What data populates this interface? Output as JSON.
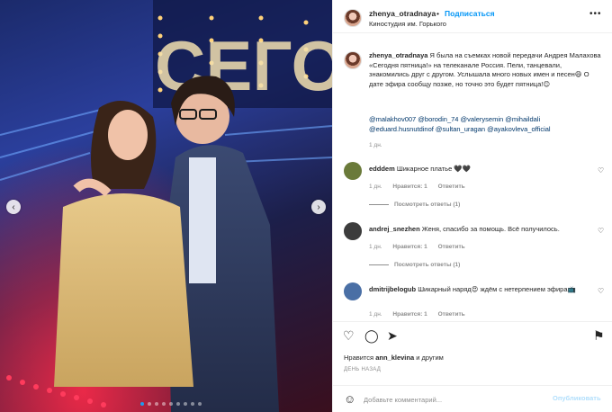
{
  "post": {
    "username": "zhenya_otradnaya",
    "separator": "•",
    "follow_label": "Подписаться",
    "location": "Киностудия им. Горького",
    "more_label": "•••",
    "photo": {
      "sign_text": "СЕГОД",
      "prev_label": "‹",
      "next_label": "›",
      "dot_count": 9,
      "active_dot": 0
    }
  },
  "caption": {
    "username": "zhenya_otradnaya",
    "text": "Я была на съемках новой передачи Андрея Малахова «Сегодня пятница!» на телеканале Россия. Пели, танцевали, знакомились друг с другом. Услышала много новых имен и песен😄 О дате эфира сообщу позже, но точно это будет пятница!😊",
    "mentions": "@malakhov007 @borodin_74 @valerysemin @mihaildali @eduard.husnutdinof @sultan_uragan @ayakovleva_official",
    "time": "1 дн."
  },
  "comments": [
    {
      "username": "edddem",
      "text": "Шикарное платье 🖤🖤",
      "time": "1 дн.",
      "likes": "Нравится: 1",
      "reply": "Ответить",
      "view_replies": "Посмотреть ответы (1)"
    },
    {
      "username": "andrej_snezhen",
      "text": "Женя, спасибо за помощь. Всё получилось.",
      "time": "1 дн.",
      "likes": "Нравится: 1",
      "reply": "Ответить",
      "view_replies": "Посмотреть ответы (1)"
    },
    {
      "username": "dmitrijbelogub",
      "text": "Шикарный наряд😍 ждём с нетерпением эфира📺",
      "time": "1 дн.",
      "likes": "Нравится: 1",
      "reply": "Ответить"
    }
  ],
  "actions": {
    "heart_icon": "♡",
    "comment_icon": "◯",
    "share_icon": "➤",
    "save_icon": "⚑",
    "small_heart": "♡"
  },
  "likes": {
    "prefix": "Нравится",
    "user": "ann_klevina",
    "suffix": "и другим"
  },
  "date_label": "ДЕНЬ НАЗАД",
  "composer": {
    "emoji_icon": "☺",
    "placeholder": "Добавьте комментарий...",
    "publish_label": "Опубликовать"
  },
  "colors": {
    "accent": "#0095f6",
    "link": "#00376b",
    "muted": "#8e8e8e",
    "publish_disabled": "#b2dffc"
  }
}
